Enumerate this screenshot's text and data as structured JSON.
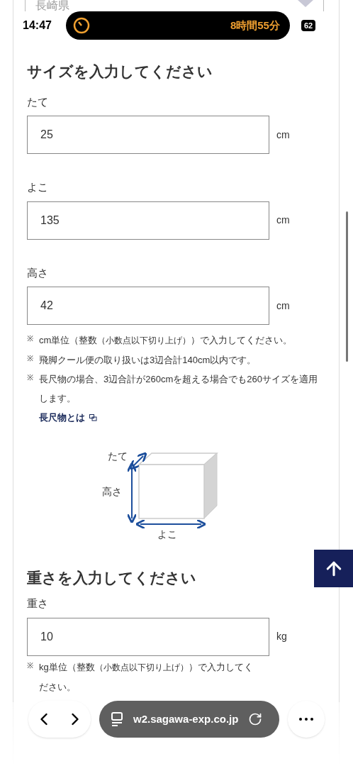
{
  "previous_field": {
    "value": "長崎県"
  },
  "status_bar": {
    "time": "14:47",
    "timer": "8時間55分",
    "battery": "62"
  },
  "size_section": {
    "title": "サイズを入力してください",
    "fields": [
      {
        "label": "たて",
        "value": "25",
        "unit": "cm"
      },
      {
        "label": "よこ",
        "value": "135",
        "unit": "cm"
      },
      {
        "label": "高さ",
        "value": "42",
        "unit": "cm"
      }
    ],
    "notes": [
      {
        "mark": "※",
        "text": "cm単位（整数",
        "small": "（小数点以下切り上げ）",
        "after": "）で入力してください。"
      },
      {
        "mark": "※",
        "text": "飛脚クール便の取り扱いは3辺合計140cm以内です。"
      },
      {
        "mark": "※",
        "text": "長尺物の場合、3辺合計が260cmを超える場合でも260サイズを適用します。"
      }
    ],
    "link": "長尺物とは",
    "diagram": {
      "depth": "たて",
      "height": "高さ",
      "width": "よこ"
    }
  },
  "weight_section": {
    "title": "重さを入力してください",
    "fields": [
      {
        "label": "重さ",
        "value": "10",
        "unit": "kg"
      }
    ],
    "notes": [
      {
        "mark": "※",
        "text": "kg単位（整数",
        "small": "（小数点以下切り上げ）",
        "after": "）で入力してください。"
      }
    ]
  },
  "browser_toolbar": {
    "url": "w2.sagawa-exp.co.jp"
  }
}
